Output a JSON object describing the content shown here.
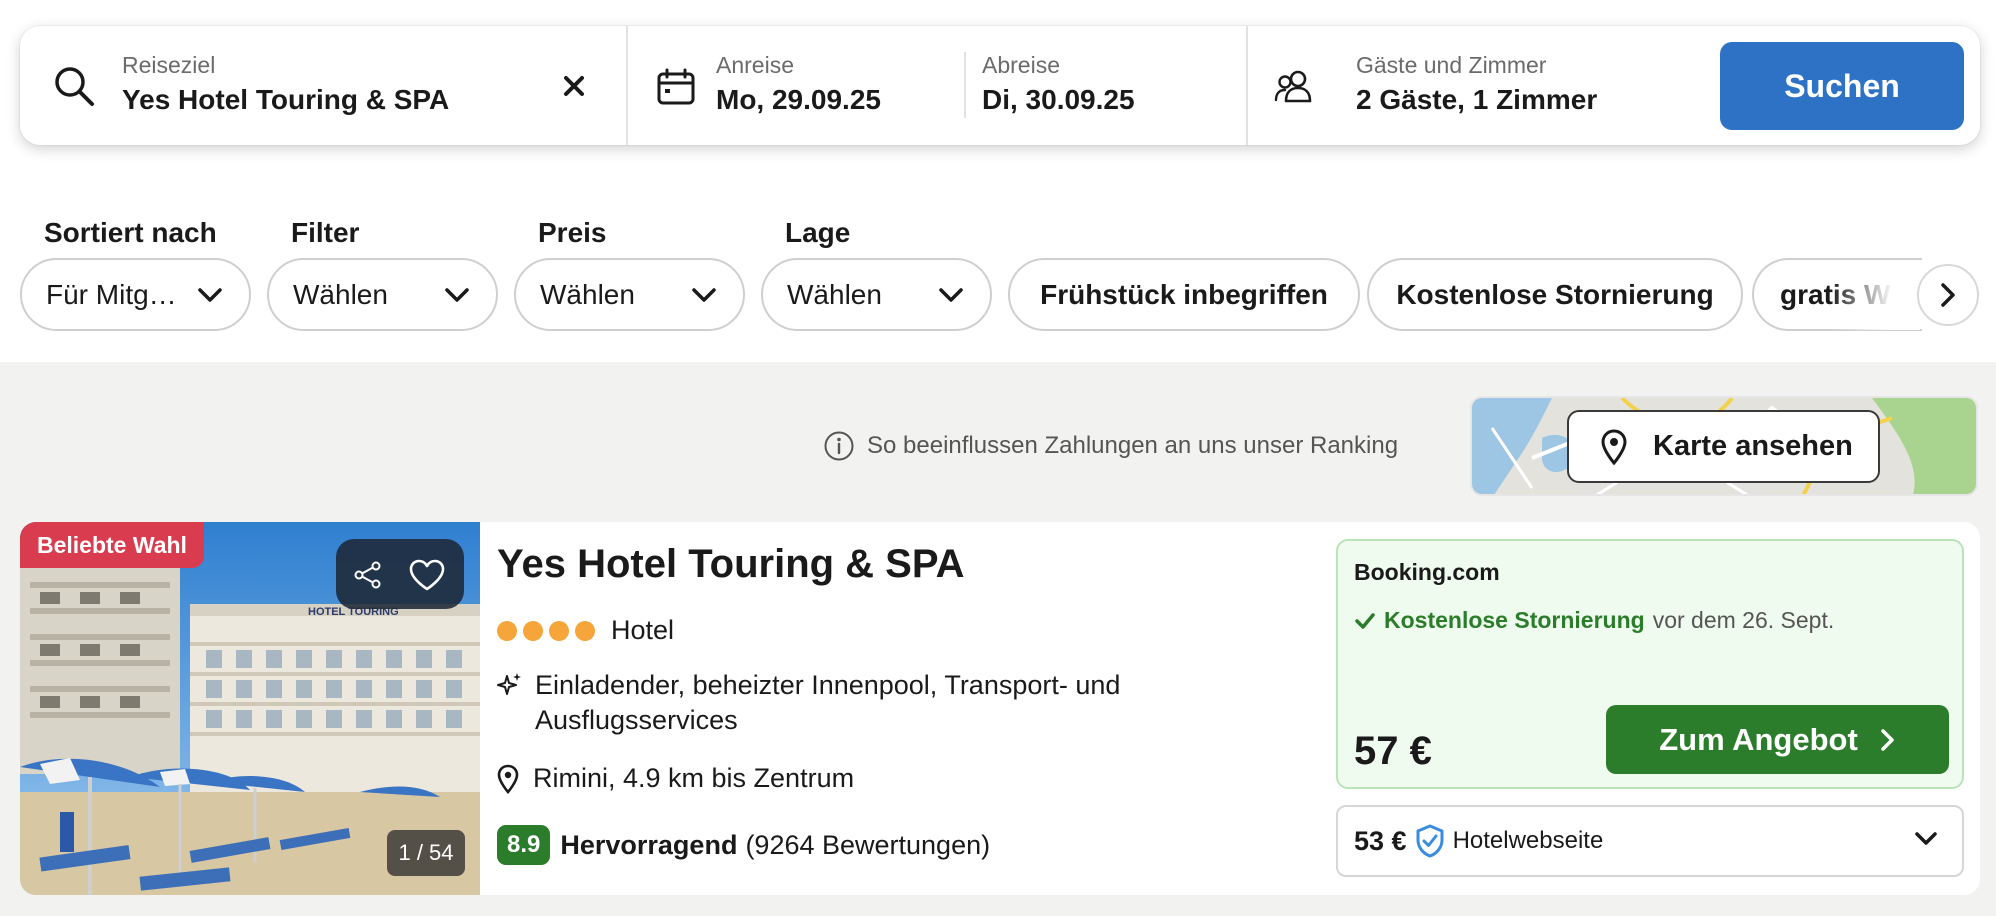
{
  "search": {
    "destination_label": "Reiseziel",
    "destination_value": "Yes Hotel Touring & SPA",
    "checkin_label": "Anreise",
    "checkin_value": "Mo, 29.09.25",
    "checkout_label": "Abreise",
    "checkout_value": "Di, 30.09.25",
    "guests_label": "Gäste und Zimmer",
    "guests_value": "2 Gäste, 1 Zimmer",
    "search_button": "Suchen"
  },
  "filters": {
    "sort_label": "Sortiert nach",
    "sort_value": "Für Mitg…",
    "filter_label": "Filter",
    "filter_value": "Wählen",
    "price_label": "Preis",
    "price_value": "Wählen",
    "location_label": "Lage",
    "location_value": "Wählen",
    "chips": [
      "Frühstück inbegriffen",
      "Kostenlose Stornierung",
      "gratis WLAN"
    ]
  },
  "ranking_info": "So beeinflussen Zahlungen an uns unser Ranking",
  "map_button": "Karte ansehen",
  "hotel": {
    "badge": "Beliebte Wahl",
    "photo_counter": "1 / 54",
    "photo_sign": "HOTEL TOURING",
    "name": "Yes Hotel Touring & SPA",
    "stars": 4,
    "type": "Hotel",
    "feature": "Einladender, beheizter Innenpool, Transport- und Ausflugsservices",
    "location": "Rimini, 4.9 km bis Zentrum",
    "score": "8.9",
    "rating_word": "Hervorragend",
    "reviews": "(9264 Bewertungen)",
    "offer": {
      "provider": "Booking.com",
      "cancel_strong": "Kostenlose Stornierung",
      "cancel_rest": "vor dem 26. Sept.",
      "price": "57 €",
      "cta": "Zum Angebot"
    },
    "alt_offer": {
      "price": "53 €",
      "source": "Hotelwebseite"
    }
  },
  "colors": {
    "primary_blue": "#2d72c4",
    "green": "#2b7d2b",
    "badge_red": "#d93c4f",
    "star_orange": "#f5a53a"
  }
}
